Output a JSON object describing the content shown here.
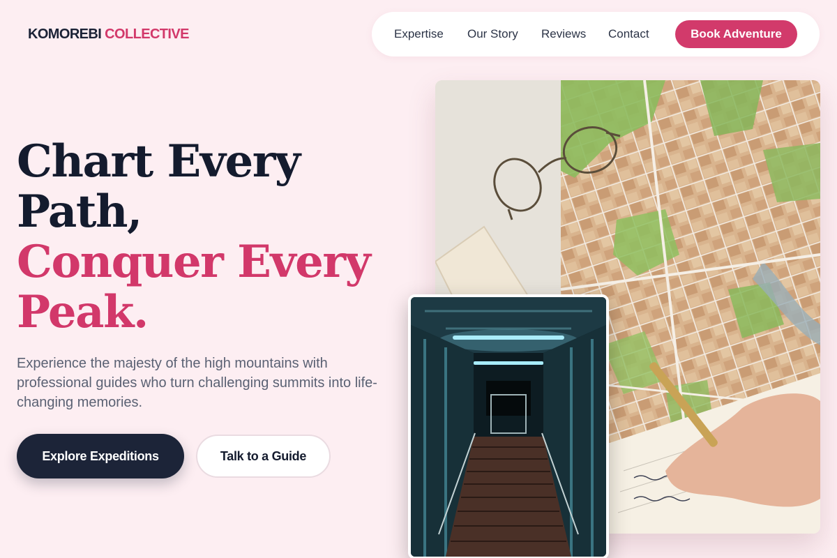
{
  "brand": {
    "name_part1": "KOMOREBI",
    "name_part2": "COLLECTIVE",
    "primary_color": "#1b2236",
    "accent_color": "#d2386a",
    "background_color": "#fdeef2"
  },
  "nav": {
    "links": [
      "Expertise",
      "Our Story",
      "Reviews",
      "Contact"
    ],
    "cta_label": "Book Adventure"
  },
  "hero": {
    "headline_line1": "Chart Every",
    "headline_line2": "Path,",
    "headline_line3": "Conquer Every",
    "headline_line4": "Peak.",
    "subtitle": "Experience the majesty of the high mountains with professional guides who turn challenging summits into life-changing memories.",
    "primary_button": "Explore Expeditions",
    "secondary_button": "Talk to a Guide"
  },
  "images": {
    "main_photo_icon": "map-photo",
    "inset_photo_icon": "stairway-photo"
  }
}
